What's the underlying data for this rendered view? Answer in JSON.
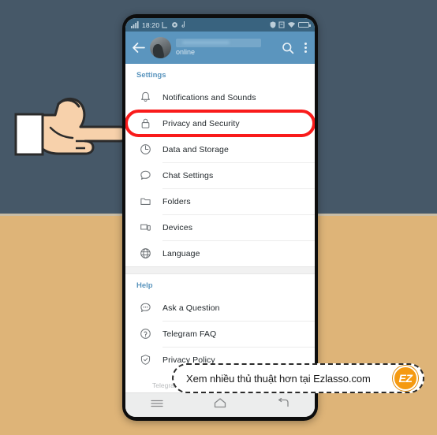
{
  "status_bar": {
    "time": "18:20",
    "left_icons": [
      "signal-icon",
      "sim-icon",
      "settings-gear-icon",
      "tiktok-note-icon"
    ],
    "right_icons": [
      "shield-icon",
      "sync-icon",
      "wifi-icon",
      "battery-icon"
    ]
  },
  "app_bar": {
    "back_icon": "back-arrow-icon",
    "avatar": "profile-avatar",
    "username_redacted": "",
    "status": "online",
    "search_icon": "search-icon",
    "overflow_icon": "overflow-menu-icon"
  },
  "sections": [
    {
      "title": "Settings",
      "items": [
        {
          "label": "Notifications and Sounds",
          "icon": "bell-icon",
          "name": "notifications-and-sounds",
          "highlighted": false
        },
        {
          "label": "Privacy and Security",
          "icon": "lock-icon",
          "name": "privacy-and-security",
          "highlighted": true
        },
        {
          "label": "Data and Storage",
          "icon": "clock-pie-icon",
          "name": "data-and-storage",
          "highlighted": false
        },
        {
          "label": "Chat Settings",
          "icon": "chat-bubble-icon",
          "name": "chat-settings",
          "highlighted": false
        },
        {
          "label": "Folders",
          "icon": "folder-icon",
          "name": "folders",
          "highlighted": false
        },
        {
          "label": "Devices",
          "icon": "devices-icon",
          "name": "devices",
          "highlighted": false
        },
        {
          "label": "Language",
          "icon": "globe-icon",
          "name": "language",
          "highlighted": false
        }
      ]
    },
    {
      "title": "Help",
      "items": [
        {
          "label": "Ask a Question",
          "icon": "chat-dots-icon",
          "name": "ask-a-question",
          "highlighted": false
        },
        {
          "label": "Telegram FAQ",
          "icon": "question-circle-icon",
          "name": "telegram-faq",
          "highlighted": false
        },
        {
          "label": "Privacy Policy",
          "icon": "shield-check-icon",
          "name": "privacy-policy",
          "highlighted": false
        }
      ]
    }
  ],
  "footnote": "Telegram fo",
  "nav_bar": {
    "menu_icon": "menu-icon",
    "home_icon": "home-icon",
    "back_icon": "back-icon"
  },
  "watermark": {
    "text": "Xem nhiều thủ thuật hơn tại Ezlasso.com",
    "badge": "EZ"
  },
  "annotation": {
    "hand": "pointing-hand-cursor",
    "highlight_color": "#f91b1b"
  },
  "colors": {
    "background_top": "#465868",
    "background_bottom": "#deb478",
    "telegram_blue": "#5b95be",
    "status_bar": "#39637f",
    "section_header": "#5b95be",
    "badge_orange": "#f59a11"
  }
}
